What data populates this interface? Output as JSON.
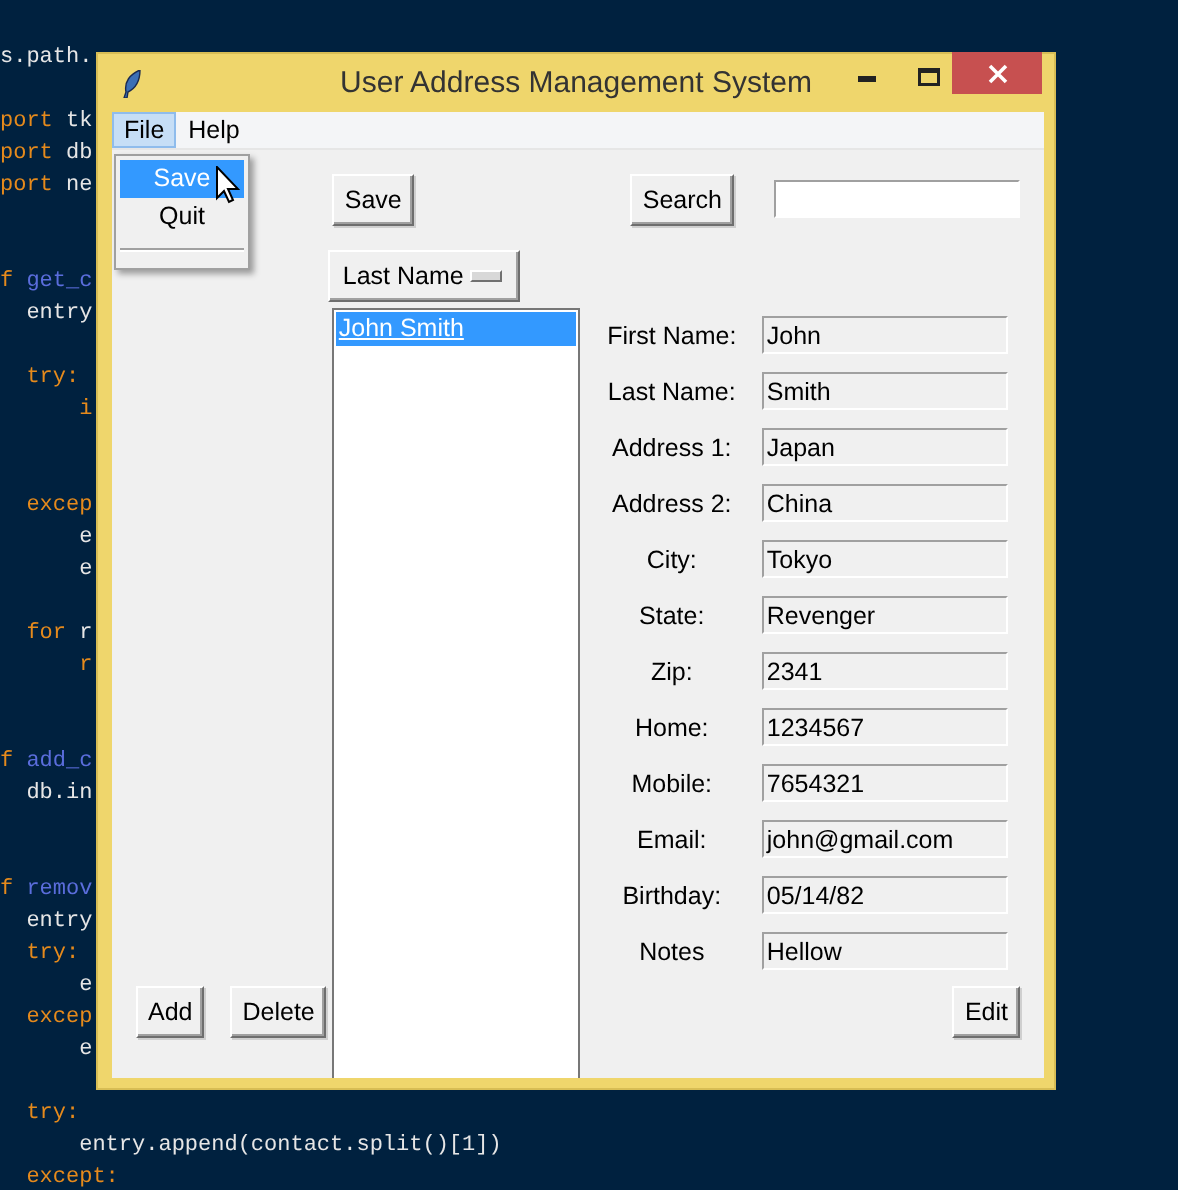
{
  "code_lines": [
    {
      "kind": "blank"
    },
    {
      "kind": "code",
      "segments": [
        {
          "kind": "plain",
          "text": "s.path."
        }
      ]
    },
    {
      "kind": "blank"
    },
    {
      "kind": "code",
      "segments": [
        {
          "kind": "keyword",
          "text": "port"
        },
        {
          "kind": "plain",
          "text": " tk"
        }
      ]
    },
    {
      "kind": "code",
      "segments": [
        {
          "kind": "keyword",
          "text": "port"
        },
        {
          "kind": "plain",
          "text": " db"
        }
      ]
    },
    {
      "kind": "code",
      "segments": [
        {
          "kind": "keyword",
          "text": "port"
        },
        {
          "kind": "plain",
          "text": " ne"
        }
      ]
    },
    {
      "kind": "blank"
    },
    {
      "kind": "blank"
    },
    {
      "kind": "code",
      "segments": [
        {
          "kind": "keyword",
          "text": "f"
        },
        {
          "kind": "name",
          "text": " get_c"
        }
      ]
    },
    {
      "kind": "code",
      "segments": [
        {
          "kind": "plain",
          "text": "  entry"
        }
      ]
    },
    {
      "kind": "blank"
    },
    {
      "kind": "code",
      "segments": [
        {
          "kind": "keyword",
          "text": "  try:"
        }
      ]
    },
    {
      "kind": "code",
      "segments": [
        {
          "kind": "keyword",
          "text": "      i"
        }
      ]
    },
    {
      "kind": "blank"
    },
    {
      "kind": "blank"
    },
    {
      "kind": "code",
      "segments": [
        {
          "kind": "keyword",
          "text": "  excep"
        }
      ]
    },
    {
      "kind": "code",
      "segments": [
        {
          "kind": "plain",
          "text": "      e"
        }
      ]
    },
    {
      "kind": "code",
      "segments": [
        {
          "kind": "plain",
          "text": "      e"
        }
      ]
    },
    {
      "kind": "blank"
    },
    {
      "kind": "code",
      "segments": [
        {
          "kind": "keyword",
          "text": "  for"
        },
        {
          "kind": "plain",
          "text": " r"
        }
      ]
    },
    {
      "kind": "code",
      "segments": [
        {
          "kind": "keyword",
          "text": "      r"
        }
      ]
    },
    {
      "kind": "blank"
    },
    {
      "kind": "blank"
    },
    {
      "kind": "code",
      "segments": [
        {
          "kind": "keyword",
          "text": "f"
        },
        {
          "kind": "name",
          "text": " add_c"
        }
      ]
    },
    {
      "kind": "code",
      "segments": [
        {
          "kind": "plain",
          "text": "  db.in"
        }
      ]
    },
    {
      "kind": "blank"
    },
    {
      "kind": "blank"
    },
    {
      "kind": "code",
      "segments": [
        {
          "kind": "keyword",
          "text": "f"
        },
        {
          "kind": "name",
          "text": " remov"
        }
      ]
    },
    {
      "kind": "code",
      "segments": [
        {
          "kind": "plain",
          "text": "  entry"
        }
      ]
    },
    {
      "kind": "code",
      "segments": [
        {
          "kind": "keyword",
          "text": "  try:"
        }
      ]
    },
    {
      "kind": "code",
      "segments": [
        {
          "kind": "plain",
          "text": "      e"
        }
      ]
    },
    {
      "kind": "code",
      "segments": [
        {
          "kind": "keyword",
          "text": "  excep"
        }
      ]
    },
    {
      "kind": "code",
      "segments": [
        {
          "kind": "plain",
          "text": "      e"
        }
      ]
    },
    {
      "kind": "blank"
    },
    {
      "kind": "code",
      "segments": [
        {
          "kind": "keyword",
          "text": "  try:"
        }
      ]
    },
    {
      "kind": "code",
      "segments": [
        {
          "kind": "plain",
          "text": "      entry.append(contact.split()[1])"
        }
      ]
    },
    {
      "kind": "code",
      "segments": [
        {
          "kind": "keyword",
          "text": "  except:"
        }
      ]
    }
  ],
  "window": {
    "title": "User Address Management System"
  },
  "menu": [
    {
      "label": "File",
      "selected": true
    },
    {
      "label": "Help",
      "selected": false
    }
  ],
  "open_menu": [
    {
      "label": "Save",
      "selected": true
    },
    {
      "label": "Quit",
      "selected": false
    }
  ],
  "save_button": "Save",
  "search_button": "Search",
  "sort_menu": "Last Name",
  "contacts": [
    {
      "label": "John Smith",
      "selected": true
    }
  ],
  "fields": [
    {
      "label": "First Name:",
      "value": "John"
    },
    {
      "label": "Last Name:",
      "value": "Smith"
    },
    {
      "label": "Address 1:",
      "value": "Japan"
    },
    {
      "label": "Address 2:",
      "value": "China"
    },
    {
      "label": "City:",
      "value": "Tokyo"
    },
    {
      "label": "State:",
      "value": "Revenger"
    },
    {
      "label": "Zip:",
      "value": "2341"
    },
    {
      "label": "Home:",
      "value": "1234567"
    },
    {
      "label": "Mobile:",
      "value": "7654321"
    },
    {
      "label": "Email:",
      "value": "john@gmail.com"
    },
    {
      "label": "Birthday:",
      "value": "05/14/82"
    },
    {
      "label": "Notes",
      "value": "Hellow"
    }
  ],
  "add_button": "Add",
  "delete_button": "Delete",
  "edit_button": "Edit"
}
